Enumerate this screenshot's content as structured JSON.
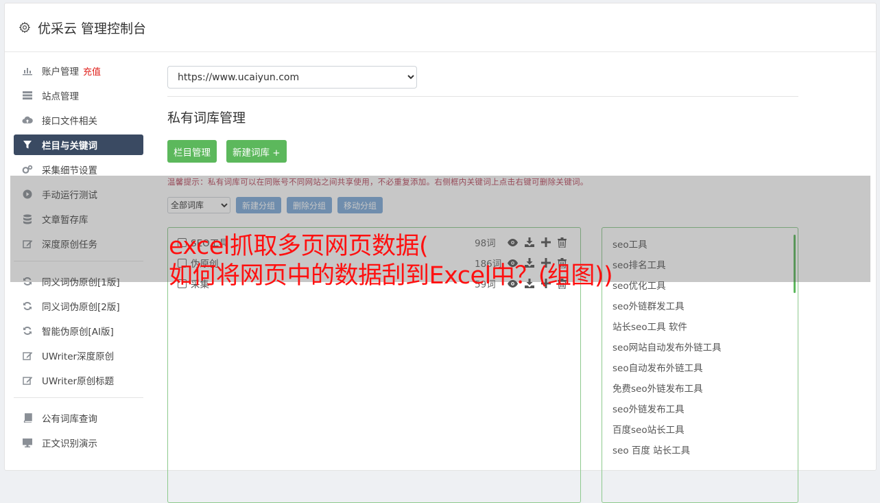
{
  "header": {
    "title": "优采云 管理控制台"
  },
  "sidebar": {
    "items": [
      {
        "label": "账户管理",
        "icon": "bar-chart-icon"
      },
      {
        "label": "站点管理",
        "icon": "server-icon"
      },
      {
        "label": "接口文件相关",
        "icon": "cloud-upload-icon"
      },
      {
        "label": "栏目与关键词",
        "icon": "filter-icon"
      },
      {
        "label": "采集细节设置",
        "icon": "cogs-icon"
      },
      {
        "label": "手动运行测试",
        "icon": "play-circle-icon"
      },
      {
        "label": "文章暂存库",
        "icon": "database-icon"
      },
      {
        "label": "深度原创任务",
        "icon": "edit-icon"
      },
      {
        "label": "同义词伪原创[1版]",
        "icon": "refresh-icon"
      },
      {
        "label": "同义词伪原创[2版]",
        "icon": "refresh-icon"
      },
      {
        "label": "智能伪原创[AI版]",
        "icon": "refresh-icon"
      },
      {
        "label": "UWriter深度原创",
        "icon": "edit-icon"
      },
      {
        "label": "UWriter原创标题",
        "icon": "edit-icon"
      },
      {
        "label": "公有词库查询",
        "icon": "book-icon"
      },
      {
        "label": "正文识别演示",
        "icon": "monitor-icon"
      }
    ],
    "recharge_label": "充值",
    "active_label": "栏目与关键词"
  },
  "main": {
    "site_select": {
      "value": "https://www.ucaiyun.com"
    },
    "page_title": "私有词库管理",
    "buttons": {
      "column_manage": "栏目管理",
      "new_library": "新建词库 +"
    },
    "hint": "温馨提示：私有词库可以在同账号不同网站之间共享使用，不必重复添加。右侧框内关键词上点击右键可删除关键词。",
    "group_select": {
      "value": "全部词库"
    },
    "group_buttons": {
      "new": "新建分组",
      "delete": "删除分组",
      "move": "移动分组"
    },
    "libraries": [
      {
        "name": "SEO工具",
        "count": "98词"
      },
      {
        "name": "伪原创",
        "count": "186词"
      },
      {
        "name": "采集",
        "count": "59词"
      }
    ],
    "keywords": [
      "seo工具",
      "seo排名工具",
      "seo优化工具",
      "seo外链群发工具",
      "站长seo工具 软件",
      "seo网站自动发布外链工具",
      "seo自动发布外链工具",
      "免费seo外链发布工具",
      "seo外链发布工具",
      "百度seo站长工具",
      "seo 百度 站长工具"
    ]
  },
  "overlay": {
    "line1": "excel抓取多页网页数据(",
    "line2": "如何将网页中的数据刮到Excel中？(组图))"
  },
  "colors": {
    "accent_green": "#5cb85c",
    "nav_active": "#3a4a62",
    "overlay_red": "#ff1010"
  }
}
